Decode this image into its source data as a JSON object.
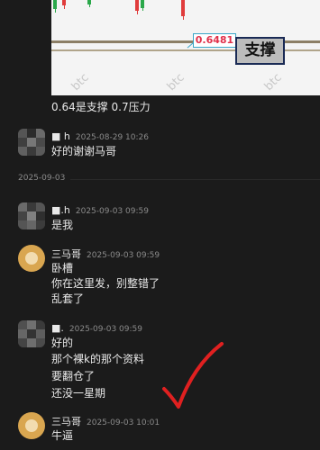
{
  "chart_image": {
    "price_label": "0.6481",
    "support_label": "支撑",
    "watermark": "btc"
  },
  "caption": "0.64是支撑 0.7压力",
  "date_separator": "2025-09-03",
  "messages": [
    {
      "sender": "■ h",
      "time": "2025-08-29 10:26",
      "lines": [
        "好的谢谢马哥"
      ],
      "avatar": "pixelated"
    },
    {
      "sender": "■.h",
      "time": "2025-09-03 09:59",
      "lines": [
        "是我"
      ],
      "avatar": "pixelated"
    },
    {
      "sender": "三马哥",
      "time": "2025-09-03 09:59",
      "lines": [
        "卧槽",
        "你在这里发，别整错了",
        "乱套了"
      ],
      "avatar": "dog"
    },
    {
      "sender": "■.",
      "time": "2025-09-03 09:59",
      "lines": [
        "好的",
        "那个裸k的那个资料",
        "要翻仓了",
        "还没一星期"
      ],
      "avatar": "pixelated"
    },
    {
      "sender": "三马哥",
      "time": "2025-09-03 10:01",
      "lines": [
        "牛逼"
      ],
      "avatar": "dog"
    }
  ],
  "colors": {
    "background": "#1b1b1b",
    "text": "#e8e8e8",
    "meta": "#8a8a8a",
    "annotation_check": "#e02020"
  }
}
